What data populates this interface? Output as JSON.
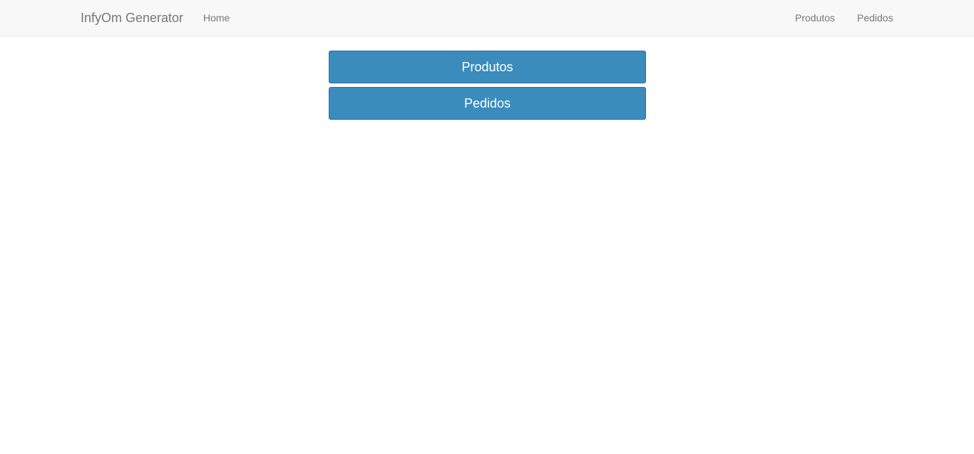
{
  "navbar": {
    "brand": "InfyOm Generator",
    "left_links": [
      {
        "label": "Home"
      }
    ],
    "right_links": [
      {
        "label": "Produtos"
      },
      {
        "label": "Pedidos"
      }
    ]
  },
  "main": {
    "buttons": [
      {
        "label": "Produtos"
      },
      {
        "label": "Pedidos"
      }
    ]
  },
  "colors": {
    "navbar_bg": "#f8f8f8",
    "button_bg": "#3a8cbc",
    "nav_text": "#777777"
  }
}
